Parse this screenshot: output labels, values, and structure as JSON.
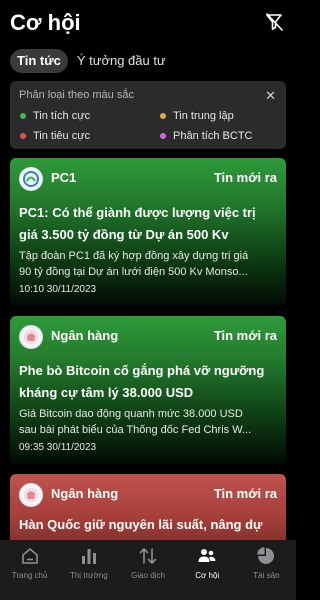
{
  "header": {
    "title": "Cơ hội",
    "filter_icon": "filter-off-icon"
  },
  "tabs": [
    {
      "label": "Tin tức",
      "active": true
    },
    {
      "label": "Ý tưởng đầu tư",
      "active": false
    }
  ],
  "legend": {
    "title": "Phân loại theo màu sắc",
    "items": [
      {
        "label": "Tin tích cực",
        "color": "#3bbf4a"
      },
      {
        "label": "Tin trung lập",
        "color": "#e0a93a"
      },
      {
        "label": "Tin tiêu cực",
        "color": "#e05252"
      },
      {
        "label": "Phân tích BCTC",
        "color": "#c86bd8"
      }
    ]
  },
  "cards": [
    {
      "source": "PC1",
      "tag": "Tin mới ra",
      "title_line1": "PC1: Có thể giành được lượng việc trị",
      "title_line2": "giá 3.500 tỷ đồng từ Dự án 500 Kv",
      "summary_line1": "Tập đoàn PC1 đã ký hợp đồng xây dựng trị giá",
      "summary_line2": "90 tỷ đồng tại Dự án lưới điện 500 Kv Monso...",
      "time": "10:10 30/11/2023",
      "sentiment": "positive",
      "color": "#2f9a3a"
    },
    {
      "source": "Ngân hàng",
      "tag": "Tin mới ra",
      "title_line1": "Phe bò Bitcoin cố gắng phá vỡ ngưỡng",
      "title_line2": "kháng cự tâm lý 38.000 USD",
      "summary_line1": "Giá Bitcoin dao động quanh mức 38.000 USD",
      "summary_line2": "sau bài phát biểu của Thống đốc Fed Chris W...",
      "time": "09:35 30/11/2023",
      "sentiment": "positive",
      "color": "#2f9a3a"
    },
    {
      "source": "Ngân hàng",
      "tag": "Tin mới ra",
      "title_line1": "Hàn Quốc giữ nguyên lãi suất, nâng dự",
      "sentiment": "negative",
      "color": "#c0534d"
    }
  ],
  "nav": [
    {
      "label": "Trang chủ",
      "icon": "home-icon",
      "active": false
    },
    {
      "label": "Thị trường",
      "icon": "bar-chart-icon",
      "active": false
    },
    {
      "label": "Giao dịch",
      "icon": "trade-arrows-icon",
      "active": false
    },
    {
      "label": "Cơ hội",
      "icon": "people-icon",
      "active": true
    },
    {
      "label": "Tài sản",
      "icon": "pie-chart-icon",
      "active": false
    }
  ]
}
